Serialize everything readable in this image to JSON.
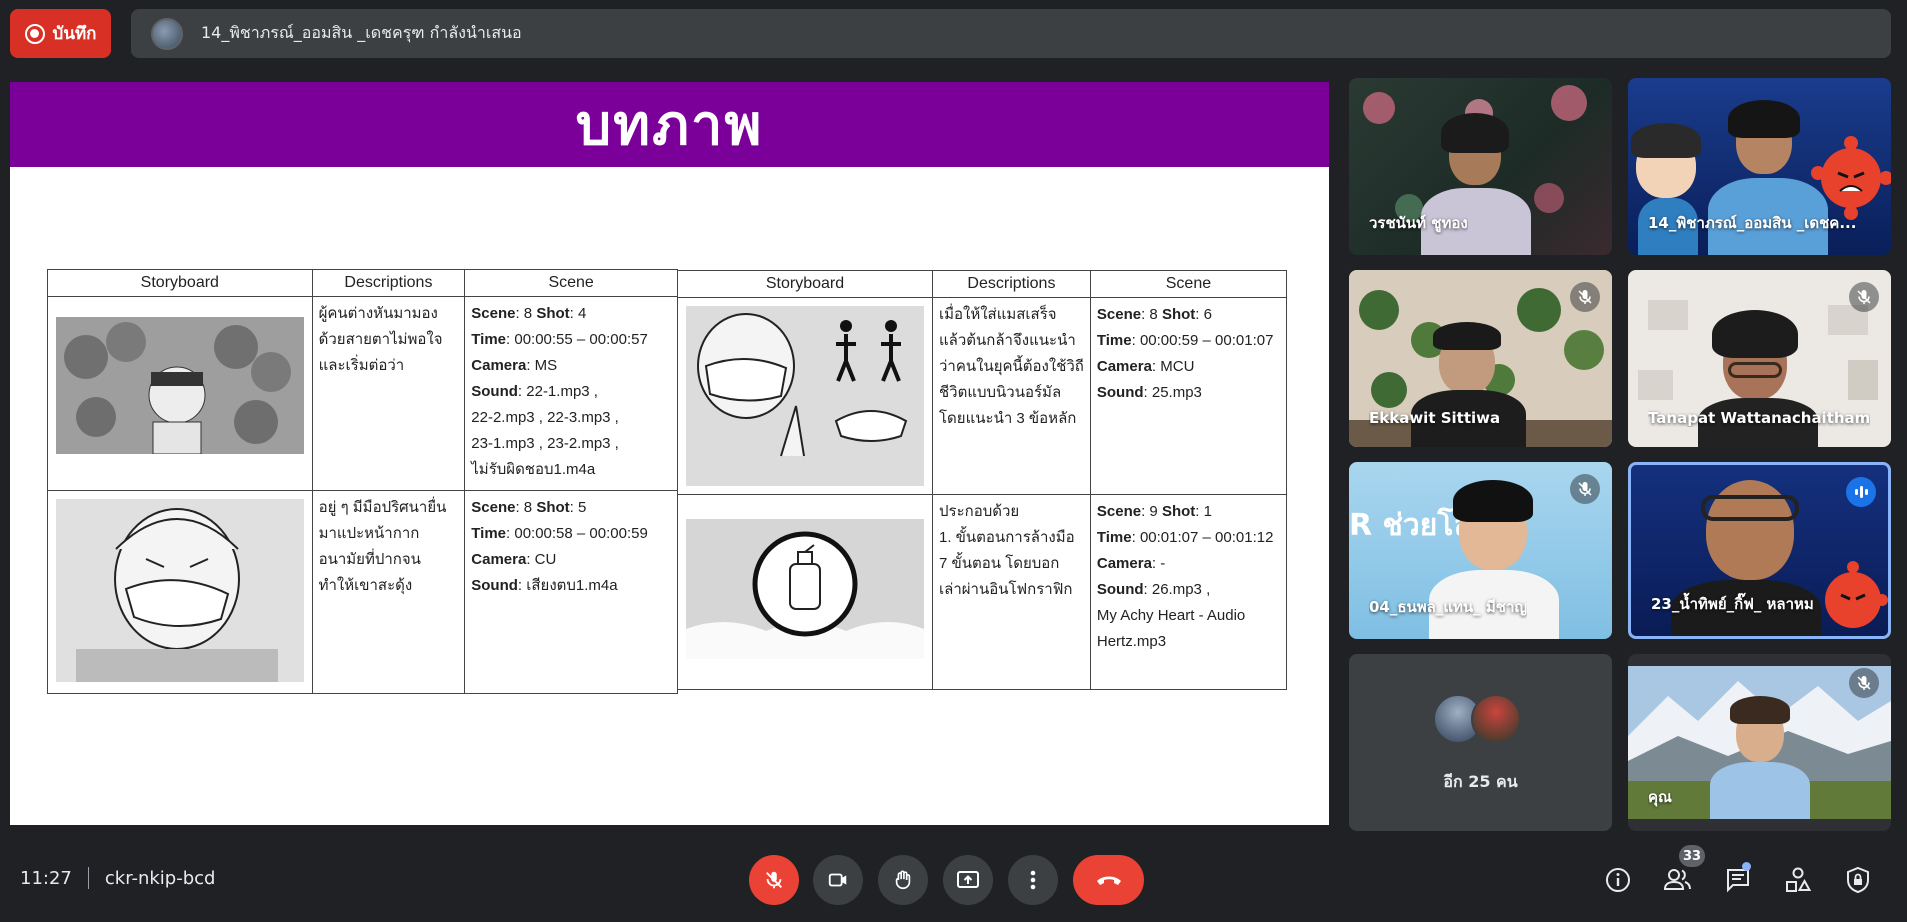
{
  "recording": {
    "label": "บันทึก"
  },
  "presenter": {
    "text": "14_พิชาภรณ์_ออมสิน _เดชครุฑ กำลังนำเสนอ"
  },
  "slide": {
    "title": "บทภาพ",
    "tables": [
      {
        "headers": [
          "Storyboard",
          "Descriptions",
          "Scene"
        ],
        "rows": [
          {
            "description": [
              "ผู้คนต่างหันมามอง",
              "ด้วยสายตาไม่พอใจ",
              "และเริ่มต่อว่า"
            ],
            "scene": {
              "scene_label": "Scene",
              "scene_no": ": 8",
              "shot_label": "Shot",
              "shot_no": ": 4",
              "time_label": "Time",
              "time": ":   00:00:55 – 00:00:57",
              "camera_label": "Camera",
              "camera": ": MS",
              "sound_label": "Sound",
              "sound": [
                ": 22-1.mp3 ,",
                "22-2.mp3 , 22-3.mp3 ,",
                "23-1.mp3 , 23-2.mp3 ,",
                "ไม่รับผิดชอบ1.m4a"
              ]
            }
          },
          {
            "description": [
              "อยู่ ๆ มีมือปริศนายื่น",
              "มาแปะหน้ากาก",
              "อนามัยที่ปากจน",
              "ทำให้เขาสะดุ้ง"
            ],
            "scene": {
              "scene_label": "Scene",
              "scene_no": ": 8",
              "shot_label": "Shot",
              "shot_no": ": 5",
              "time_label": "Time",
              "time": ":   00:00:58 – 00:00:59",
              "camera_label": "Camera",
              "camera": ": CU",
              "sound_label": "Sound",
              "sound": [
                ": เสียงตบ1.m4a"
              ]
            }
          }
        ]
      },
      {
        "headers": [
          "Storyboard",
          "Descriptions",
          "Scene"
        ],
        "rows": [
          {
            "description": [
              "เมื่อให้ใส่แมสเสร็จ",
              "แล้วต้นกล้าจึงแนะนำ",
              "ว่าคนในยุคนี้ต้องใช้วิถี",
              "ชีวิตแบบนิวนอร์มัล",
              "โดยแนะนำ 3 ข้อหลัก"
            ],
            "scene": {
              "scene_label": "Scene",
              "scene_no": ": 8",
              "shot_label": "Shot",
              "shot_no": ": 6",
              "time_label": "Time",
              "time": ":   00:00:59 – 00:01:07",
              "camera_label": "Camera",
              "camera": ": MCU",
              "sound_label": "Sound",
              "sound": [
                ": 25.mp3"
              ]
            }
          },
          {
            "description": [
              "ประกอบด้วย",
              "1. ขั้นตอนการล้างมือ",
              "7 ขั้นตอน โดยบอก",
              "เล่าผ่านอินโฟกราฟิก"
            ],
            "scene": {
              "scene_label": "Scene",
              "scene_no": ": 9",
              "shot_label": "Shot",
              "shot_no": ": 1",
              "time_label": "Time",
              "time": ":   00:01:07 – 00:01:12",
              "camera_label": "Camera",
              "camera": ": -",
              "sound_label": "Sound",
              "sound": [
                ": 26.mp3 ,",
                "My Achy Heart - Audio",
                "Hertz.mp3"
              ]
            }
          }
        ]
      }
    ]
  },
  "participants": [
    {
      "name": "วรชนันท์ ชูทอง"
    },
    {
      "name": "14_พิชาภรณ์_ออมสิน _เดชค..."
    },
    {
      "name": "Ekkawit Sittiwa"
    },
    {
      "name": "Tanapat Wattanachaitham"
    },
    {
      "name": "04_ธนพล_แทน_ มีชาญ",
      "bg_text": "R ช่วยโล"
    },
    {
      "name": "23_น้ำทิพย์_กิ๊ฟ_ หลาหม"
    },
    {
      "name": "อีก 25 คน"
    },
    {
      "name": "คุณ"
    }
  ],
  "meeting": {
    "time": "11:27",
    "code": "ckr-nkip-bcd"
  },
  "controls": {
    "people_count": "33",
    "icons": [
      "mic-off-icon",
      "camera-icon",
      "hand-icon",
      "present-icon",
      "more-icon",
      "end-call-icon",
      "info-icon",
      "people-icon",
      "chat-icon",
      "activities-icon",
      "host-controls-icon"
    ]
  },
  "colors": {
    "slide_header": "#7b0099",
    "end_call": "#ea4335",
    "bar": "#3c4043",
    "bg": "#202124"
  }
}
